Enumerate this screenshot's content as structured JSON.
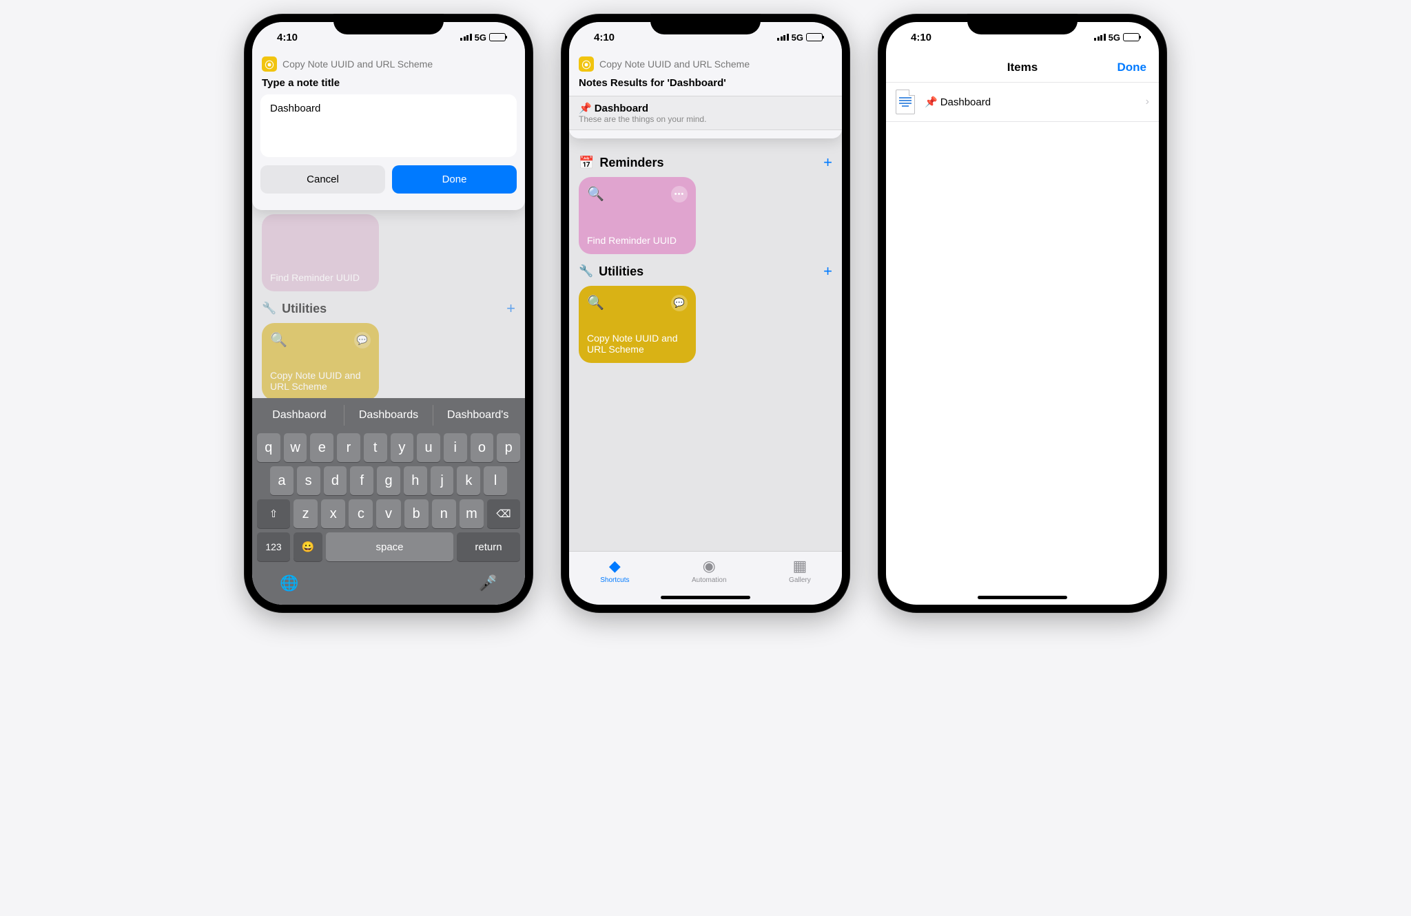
{
  "status": {
    "time": "4:10",
    "network": "5G"
  },
  "sheet": {
    "shortcut_name": "Copy Note UUID and URL Scheme",
    "prompt": "Type a note title",
    "input_value": "Dashboard",
    "cancel": "Cancel",
    "done": "Done"
  },
  "results": {
    "title": "Notes Results for 'Dashboard'",
    "item_emoji": "📌",
    "item_name": "Dashboard",
    "item_sub": "These are the things on your mind."
  },
  "sections": {
    "reminders": {
      "title": "Reminders",
      "tile": "Find Reminder UUID"
    },
    "utilities": {
      "title": "Utilities",
      "tile": "Copy Note UUID and URL Scheme"
    }
  },
  "keyboard": {
    "suggestions": [
      "Dashbaord",
      "Dashboards",
      "Dashboard's"
    ],
    "row1": [
      "q",
      "w",
      "e",
      "r",
      "t",
      "y",
      "u",
      "i",
      "o",
      "p"
    ],
    "row2": [
      "a",
      "s",
      "d",
      "f",
      "g",
      "h",
      "j",
      "k",
      "l"
    ],
    "row3": [
      "z",
      "x",
      "c",
      "v",
      "b",
      "n",
      "m"
    ],
    "num": "123",
    "space": "space",
    "return": "return"
  },
  "tabs": {
    "shortcuts": "Shortcuts",
    "automation": "Automation",
    "gallery": "Gallery"
  },
  "items_screen": {
    "title": "Items",
    "done": "Done",
    "row_emoji": "📌",
    "row_name": "Dashboard"
  }
}
